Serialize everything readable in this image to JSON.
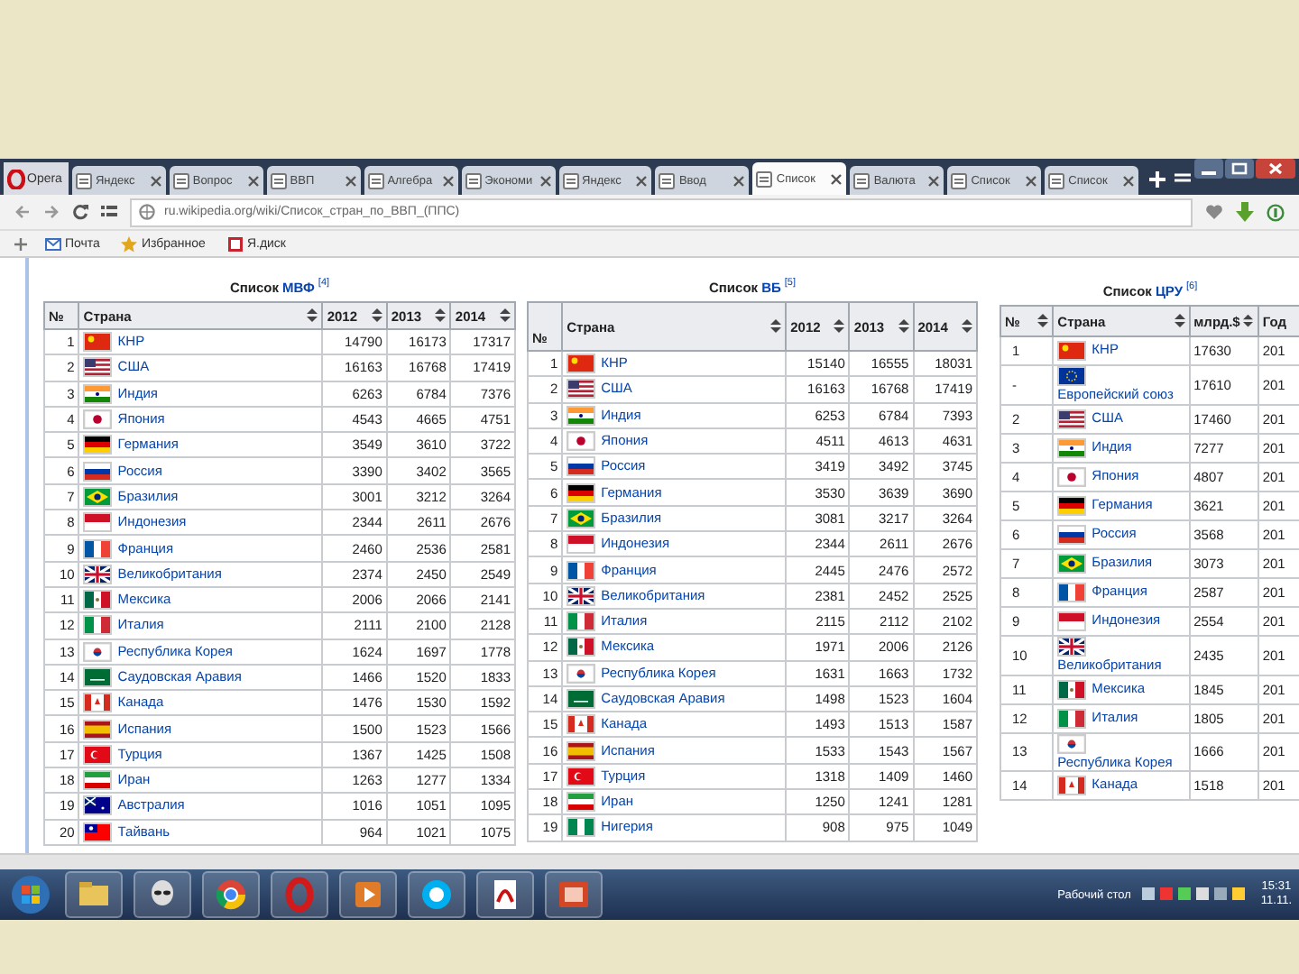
{
  "browser": {
    "menu_label": "Opera",
    "tabs": [
      {
        "title": "Яндекс",
        "selected": false
      },
      {
        "title": "Вопрос",
        "selected": false
      },
      {
        "title": "ВВП",
        "selected": false
      },
      {
        "title": "Алгебра",
        "selected": false
      },
      {
        "title": "Экономи",
        "selected": false
      },
      {
        "title": "Яндекс",
        "selected": false
      },
      {
        "title": "Ввод",
        "selected": false
      },
      {
        "title": "Список",
        "selected": true
      },
      {
        "title": "Валюта",
        "selected": false
      },
      {
        "title": "Список",
        "selected": false
      },
      {
        "title": "Список",
        "selected": false
      }
    ],
    "address": "ru.wikipedia.org/wiki/Список_стран_по_ВВП_(ППС)",
    "bookmarks": [
      "Почта",
      "Избранное",
      "Я.диск"
    ]
  },
  "tables": [
    {
      "caption": {
        "prefix": "Список",
        "link": "МВФ",
        "note": "[4]"
      },
      "columns": [
        {
          "label": "№",
          "sortable": false
        },
        {
          "label": "Страна",
          "sortable": true
        },
        {
          "label": "2012",
          "sortable": true
        },
        {
          "label": "2013",
          "sortable": true
        },
        {
          "label": "2014",
          "sortable": true
        }
      ],
      "rows": [
        {
          "rank": "1",
          "country": "КНР",
          "kind": "cn",
          "values": [
            "14790",
            "16173",
            "17317"
          ]
        },
        {
          "rank": "2",
          "country": "США",
          "kind": "us",
          "values": [
            "16163",
            "16768",
            "17419"
          ]
        },
        {
          "rank": "3",
          "country": "Индия",
          "kind": "in",
          "values": [
            "6263",
            "6784",
            "7376"
          ]
        },
        {
          "rank": "4",
          "country": "Япония",
          "kind": "jp",
          "values": [
            "4543",
            "4665",
            "4751"
          ]
        },
        {
          "rank": "5",
          "country": "Германия",
          "kind": "de",
          "values": [
            "3549",
            "3610",
            "3722"
          ]
        },
        {
          "rank": "6",
          "country": "Россия",
          "kind": "ru",
          "values": [
            "3390",
            "3402",
            "3565"
          ]
        },
        {
          "rank": "7",
          "country": "Бразилия",
          "kind": "br",
          "values": [
            "3001",
            "3212",
            "3264"
          ]
        },
        {
          "rank": "8",
          "country": "Индонезия",
          "kind": "id",
          "values": [
            "2344",
            "2611",
            "2676"
          ]
        },
        {
          "rank": "9",
          "country": "Франция",
          "kind": "fr",
          "values": [
            "2460",
            "2536",
            "2581"
          ]
        },
        {
          "rank": "10",
          "country": "Великобритания",
          "kind": "gb",
          "values": [
            "2374",
            "2450",
            "2549"
          ]
        },
        {
          "rank": "11",
          "country": "Мексика",
          "kind": "mx",
          "values": [
            "2006",
            "2066",
            "2141"
          ]
        },
        {
          "rank": "12",
          "country": "Италия",
          "kind": "it",
          "values": [
            "2111",
            "2100",
            "2128"
          ]
        },
        {
          "rank": "13",
          "country": "Республика Корея",
          "kind": "kr",
          "values": [
            "1624",
            "1697",
            "1778"
          ]
        },
        {
          "rank": "14",
          "country": "Саудовская Аравия",
          "kind": "sa",
          "values": [
            "1466",
            "1520",
            "1833"
          ]
        },
        {
          "rank": "15",
          "country": "Канада",
          "kind": "ca",
          "values": [
            "1476",
            "1530",
            "1592"
          ]
        },
        {
          "rank": "16",
          "country": "Испания",
          "kind": "es",
          "values": [
            "1500",
            "1523",
            "1566"
          ]
        },
        {
          "rank": "17",
          "country": "Турция",
          "kind": "tr",
          "values": [
            "1367",
            "1425",
            "1508"
          ]
        },
        {
          "rank": "18",
          "country": "Иран",
          "kind": "ir",
          "values": [
            "1263",
            "1277",
            "1334"
          ]
        },
        {
          "rank": "19",
          "country": "Австралия",
          "kind": "au",
          "values": [
            "1016",
            "1051",
            "1095"
          ]
        },
        {
          "rank": "20",
          "country": "Тайвань",
          "kind": "tw",
          "values": [
            "964",
            "1021",
            "1075"
          ]
        }
      ]
    },
    {
      "caption": {
        "prefix": "Список",
        "link": "ВБ",
        "note": "[5]"
      },
      "columns": [
        {
          "label": "№",
          "sortable": false
        },
        {
          "label": "Страна",
          "sortable": true
        },
        {
          "label": "2012",
          "sortable": true
        },
        {
          "label": "2013",
          "sortable": true
        },
        {
          "label": "2014",
          "sortable": true
        }
      ],
      "rows": [
        {
          "rank": "1",
          "country": "КНР",
          "kind": "cn",
          "values": [
            "15140",
            "16555",
            "18031"
          ]
        },
        {
          "rank": "2",
          "country": "США",
          "kind": "us",
          "values": [
            "16163",
            "16768",
            "17419"
          ]
        },
        {
          "rank": "3",
          "country": "Индия",
          "kind": "in",
          "values": [
            "6253",
            "6784",
            "7393"
          ]
        },
        {
          "rank": "4",
          "country": "Япония",
          "kind": "jp",
          "values": [
            "4511",
            "4613",
            "4631"
          ]
        },
        {
          "rank": "5",
          "country": "Россия",
          "kind": "ru",
          "values": [
            "3419",
            "3492",
            "3745"
          ]
        },
        {
          "rank": "6",
          "country": "Германия",
          "kind": "de",
          "values": [
            "3530",
            "3639",
            "3690"
          ]
        },
        {
          "rank": "7",
          "country": "Бразилия",
          "kind": "br",
          "values": [
            "3081",
            "3217",
            "3264"
          ]
        },
        {
          "rank": "8",
          "country": "Индонезия",
          "kind": "id",
          "values": [
            "2344",
            "2611",
            "2676"
          ]
        },
        {
          "rank": "9",
          "country": "Франция",
          "kind": "fr",
          "values": [
            "2445",
            "2476",
            "2572"
          ]
        },
        {
          "rank": "10",
          "country": "Великобритания",
          "kind": "gb",
          "values": [
            "2381",
            "2452",
            "2525"
          ]
        },
        {
          "rank": "11",
          "country": "Италия",
          "kind": "it",
          "values": [
            "2115",
            "2112",
            "2102"
          ]
        },
        {
          "rank": "12",
          "country": "Мексика",
          "kind": "mx",
          "values": [
            "1971",
            "2006",
            "2126"
          ]
        },
        {
          "rank": "13",
          "country": "Республика Корея",
          "kind": "kr",
          "values": [
            "1631",
            "1663",
            "1732"
          ]
        },
        {
          "rank": "14",
          "country": "Саудовская Аравия",
          "kind": "sa",
          "values": [
            "1498",
            "1523",
            "1604"
          ]
        },
        {
          "rank": "15",
          "country": "Канада",
          "kind": "ca",
          "values": [
            "1493",
            "1513",
            "1587"
          ]
        },
        {
          "rank": "16",
          "country": "Испания",
          "kind": "es",
          "values": [
            "1533",
            "1543",
            "1567"
          ]
        },
        {
          "rank": "17",
          "country": "Турция",
          "kind": "tr",
          "values": [
            "1318",
            "1409",
            "1460"
          ]
        },
        {
          "rank": "18",
          "country": "Иран",
          "kind": "ir",
          "values": [
            "1250",
            "1241",
            "1281"
          ]
        },
        {
          "rank": "19",
          "country": "Нигерия",
          "kind": "ng",
          "values": [
            "908",
            "975",
            "1049"
          ]
        }
      ]
    },
    {
      "caption": {
        "prefix": "Список",
        "link": "ЦРУ",
        "note": "[6]"
      },
      "columns": [
        {
          "label": "№",
          "sortable": true
        },
        {
          "label": "Страна",
          "sortable": true
        },
        {
          "label": "млрд.$",
          "sortable": true
        },
        {
          "label": "Год",
          "sortable": false
        }
      ],
      "rows": [
        {
          "rank": "1",
          "country": "КНР",
          "kind": "cn",
          "values": [
            "17630",
            "201"
          ]
        },
        {
          "rank": "-",
          "country": "Европейский союз",
          "kind": "eu",
          "values": [
            "17610",
            "201"
          ]
        },
        {
          "rank": "2",
          "country": "США",
          "kind": "us",
          "values": [
            "17460",
            "201"
          ]
        },
        {
          "rank": "3",
          "country": "Индия",
          "kind": "in",
          "values": [
            "7277",
            "201"
          ]
        },
        {
          "rank": "4",
          "country": "Япония",
          "kind": "jp",
          "values": [
            "4807",
            "201"
          ]
        },
        {
          "rank": "5",
          "country": "Германия",
          "kind": "de",
          "values": [
            "3621",
            "201"
          ]
        },
        {
          "rank": "6",
          "country": "Россия",
          "kind": "ru",
          "values": [
            "3568",
            "201"
          ]
        },
        {
          "rank": "7",
          "country": "Бразилия",
          "kind": "br",
          "values": [
            "3073",
            "201"
          ]
        },
        {
          "rank": "8",
          "country": "Франция",
          "kind": "fr",
          "values": [
            "2587",
            "201"
          ]
        },
        {
          "rank": "9",
          "country": "Индонезия",
          "kind": "id",
          "values": [
            "2554",
            "201"
          ]
        },
        {
          "rank": "10",
          "country": "Великобритания",
          "kind": "gb",
          "values": [
            "2435",
            "201"
          ]
        },
        {
          "rank": "11",
          "country": "Мексика",
          "kind": "mx",
          "values": [
            "1845",
            "201"
          ]
        },
        {
          "rank": "12",
          "country": "Италия",
          "kind": "it",
          "values": [
            "1805",
            "201"
          ]
        },
        {
          "rank": "13",
          "country": "Республика Корея",
          "kind": "kr",
          "values": [
            "1666",
            "201"
          ]
        },
        {
          "rank": "14",
          "country": "Канада",
          "kind": "ca",
          "values": [
            "1518",
            "201"
          ]
        }
      ]
    }
  ],
  "taskbar": {
    "desktop_label": "Рабочий стол",
    "time": "15:31",
    "date": "11.11."
  }
}
